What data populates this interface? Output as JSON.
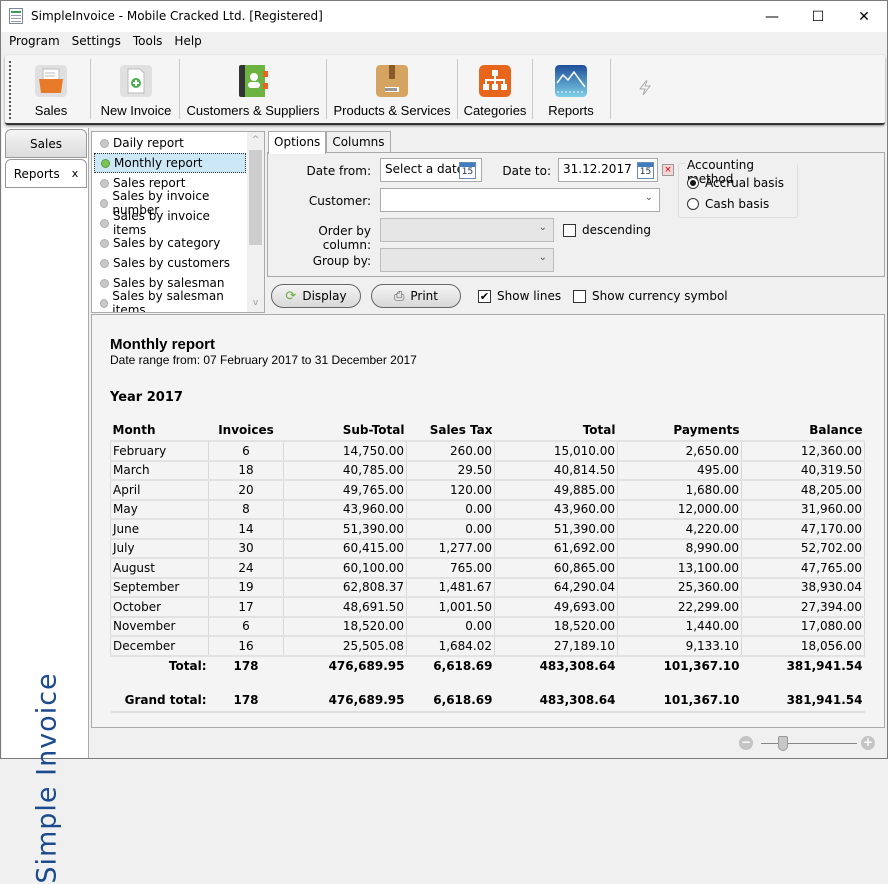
{
  "window": {
    "title": "SimpleInvoice - Mobile Cracked Ltd.   [Registered]",
    "minimize": "—",
    "maximize": "☐",
    "close": "✕"
  },
  "menu": [
    "Program",
    "Settings",
    "Tools",
    "Help"
  ],
  "toolbar": {
    "buttons": [
      {
        "label": "Sales",
        "icon": "sales-folder-icon",
        "color": "#e87b2a"
      },
      {
        "label": "New Invoice",
        "icon": "new-invoice-icon",
        "color": "#4caf50"
      },
      {
        "label": "Customers & Suppliers",
        "icon": "address-book-icon",
        "color": "#6cb33f"
      },
      {
        "label": "Products & Services",
        "icon": "package-box-icon",
        "color": "#c99550"
      },
      {
        "label": "Categories",
        "icon": "hierarchy-icon",
        "color": "#e8661c"
      },
      {
        "label": "Reports",
        "icon": "chart-icon",
        "color": "#2b6cb5"
      }
    ],
    "extra_icon": "lightning-icon"
  },
  "nav_tabs": {
    "sales": "Sales",
    "reports": "Reports",
    "reports_close": "x"
  },
  "brand": "Simple Invoice",
  "report_list": {
    "items": [
      "Daily report",
      "Monthly report",
      "Sales report",
      "Sales by invoice number",
      "Sales by invoice items",
      "Sales by category",
      "Sales by customers",
      "Sales by salesman",
      "Sales by salesman items"
    ],
    "selected": "Monthly report",
    "scroll_up": "^",
    "scroll_down": "v"
  },
  "options": {
    "tabs": [
      "Options",
      "Columns"
    ],
    "active_tab": "Options",
    "date_from_label": "Date from:",
    "date_from_value": "Select a date",
    "date_to_label": "Date to:",
    "date_to_value": "31.12.2017",
    "calendar_day": "15",
    "clear_date": "×",
    "customer_label": "Customer:",
    "customer_value": "",
    "order_label": "Order by column:",
    "order_value": "",
    "descending_label": "descending",
    "descending_checked": false,
    "group_label": "Group by:",
    "group_value": "",
    "accounting": {
      "title": "Accounting method",
      "options": [
        "Accrual basis",
        "Cash basis"
      ],
      "selected": "Accrual basis"
    },
    "display_label": "Display",
    "print_label": "Print",
    "show_lines_label": "Show lines",
    "show_lines_checked": true,
    "show_currency_label": "Show currency symbol",
    "show_currency_checked": false
  },
  "report": {
    "title": "Monthly report",
    "range": "Date range from: 07 February 2017 to 31 December 2017",
    "year": "Year 2017",
    "columns": [
      "Month",
      "Invoices",
      "Sub-Total",
      "Sales Tax",
      "Total",
      "Payments",
      "Balance"
    ],
    "rows": [
      [
        "February",
        "6",
        "14,750.00",
        "260.00",
        "15,010.00",
        "2,650.00",
        "12,360.00"
      ],
      [
        "March",
        "18",
        "40,785.00",
        "29.50",
        "40,814.50",
        "495.00",
        "40,319.50"
      ],
      [
        "April",
        "20",
        "49,765.00",
        "120.00",
        "49,885.00",
        "1,680.00",
        "48,205.00"
      ],
      [
        "May",
        "8",
        "43,960.00",
        "0.00",
        "43,960.00",
        "12,000.00",
        "31,960.00"
      ],
      [
        "June",
        "14",
        "51,390.00",
        "0.00",
        "51,390.00",
        "4,220.00",
        "47,170.00"
      ],
      [
        "July",
        "30",
        "60,415.00",
        "1,277.00",
        "61,692.00",
        "8,990.00",
        "52,702.00"
      ],
      [
        "August",
        "24",
        "60,100.00",
        "765.00",
        "60,865.00",
        "13,100.00",
        "47,765.00"
      ],
      [
        "September",
        "19",
        "62,808.37",
        "1,481.67",
        "64,290.04",
        "25,360.00",
        "38,930.04"
      ],
      [
        "October",
        "17",
        "48,691.50",
        "1,001.50",
        "49,693.00",
        "22,299.00",
        "27,394.00"
      ],
      [
        "November",
        "6",
        "18,520.00",
        "0.00",
        "18,520.00",
        "1,440.00",
        "17,080.00"
      ],
      [
        "December",
        "16",
        "25,505.08",
        "1,684.02",
        "27,189.10",
        "9,133.10",
        "18,056.00"
      ]
    ],
    "total": [
      "Total:",
      "178",
      "476,689.95",
      "6,618.69",
      "483,308.64",
      "101,367.10",
      "381,941.54"
    ],
    "grand_total": [
      "Grand total:",
      "178",
      "476,689.95",
      "6,618.69",
      "483,308.64",
      "101,367.10",
      "381,941.54"
    ]
  },
  "zoom": {
    "minus": "−",
    "plus": "+",
    "level_fraction": 0.2
  }
}
